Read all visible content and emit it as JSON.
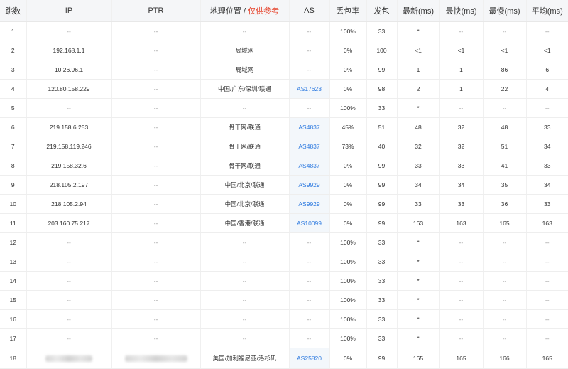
{
  "columns": {
    "hop": "跳数",
    "ip": "IP",
    "ptr": "PTR",
    "geo": "地理位置",
    "geo_sep": "/",
    "geo_note": "仅供参考",
    "as": "AS",
    "loss": "丢包率",
    "sent": "发包",
    "last": "最新(ms)",
    "best": "最快(ms)",
    "worst": "最慢(ms)",
    "avg": "平均(ms)"
  },
  "rows": [
    {
      "hop": "1",
      "ip": "--",
      "ptr": "--",
      "geo": "--",
      "as": "--",
      "loss": "100%",
      "sent": "33",
      "last": "*",
      "best": "--",
      "worst": "--",
      "avg": "--"
    },
    {
      "hop": "2",
      "ip": "192.168.1.1",
      "ptr": "--",
      "geo": "局域网",
      "as": "--",
      "loss": "0%",
      "sent": "100",
      "last": "<1",
      "best": "<1",
      "worst": "<1",
      "avg": "<1"
    },
    {
      "hop": "3",
      "ip": "10.26.96.1",
      "ptr": "--",
      "geo": "局域网",
      "as": "--",
      "loss": "0%",
      "sent": "99",
      "last": "1",
      "best": "1",
      "worst": "86",
      "avg": "6"
    },
    {
      "hop": "4",
      "ip": "120.80.158.229",
      "ptr": "--",
      "geo": "中国/广东/深圳/联通",
      "as": "AS17623",
      "loss": "0%",
      "sent": "98",
      "last": "2",
      "best": "1",
      "worst": "22",
      "avg": "4"
    },
    {
      "hop": "5",
      "ip": "--",
      "ptr": "--",
      "geo": "--",
      "as": "--",
      "loss": "100%",
      "sent": "33",
      "last": "*",
      "best": "--",
      "worst": "--",
      "avg": "--"
    },
    {
      "hop": "6",
      "ip": "219.158.6.253",
      "ptr": "--",
      "geo": "骨干网/联通",
      "as": "AS4837",
      "loss": "45%",
      "sent": "51",
      "last": "48",
      "best": "32",
      "worst": "48",
      "avg": "33"
    },
    {
      "hop": "7",
      "ip": "219.158.119.246",
      "ptr": "--",
      "geo": "骨干网/联通",
      "as": "AS4837",
      "loss": "73%",
      "sent": "40",
      "last": "32",
      "best": "32",
      "worst": "51",
      "avg": "34"
    },
    {
      "hop": "8",
      "ip": "219.158.32.6",
      "ptr": "--",
      "geo": "骨干网/联通",
      "as": "AS4837",
      "loss": "0%",
      "sent": "99",
      "last": "33",
      "best": "33",
      "worst": "41",
      "avg": "33"
    },
    {
      "hop": "9",
      "ip": "218.105.2.197",
      "ptr": "--",
      "geo": "中国/北京/联通",
      "as": "AS9929",
      "loss": "0%",
      "sent": "99",
      "last": "34",
      "best": "34",
      "worst": "35",
      "avg": "34"
    },
    {
      "hop": "10",
      "ip": "218.105.2.94",
      "ptr": "--",
      "geo": "中国/北京/联通",
      "as": "AS9929",
      "loss": "0%",
      "sent": "99",
      "last": "33",
      "best": "33",
      "worst": "36",
      "avg": "33"
    },
    {
      "hop": "11",
      "ip": "203.160.75.217",
      "ptr": "--",
      "geo": "中国/香港/联通",
      "as": "AS10099",
      "loss": "0%",
      "sent": "99",
      "last": "163",
      "best": "163",
      "worst": "165",
      "avg": "163"
    },
    {
      "hop": "12",
      "ip": "--",
      "ptr": "--",
      "geo": "--",
      "as": "--",
      "loss": "100%",
      "sent": "33",
      "last": "*",
      "best": "--",
      "worst": "--",
      "avg": "--"
    },
    {
      "hop": "13",
      "ip": "--",
      "ptr": "--",
      "geo": "--",
      "as": "--",
      "loss": "100%",
      "sent": "33",
      "last": "*",
      "best": "--",
      "worst": "--",
      "avg": "--"
    },
    {
      "hop": "14",
      "ip": "--",
      "ptr": "--",
      "geo": "--",
      "as": "--",
      "loss": "100%",
      "sent": "33",
      "last": "*",
      "best": "--",
      "worst": "--",
      "avg": "--"
    },
    {
      "hop": "15",
      "ip": "--",
      "ptr": "--",
      "geo": "--",
      "as": "--",
      "loss": "100%",
      "sent": "33",
      "last": "*",
      "best": "--",
      "worst": "--",
      "avg": "--"
    },
    {
      "hop": "16",
      "ip": "--",
      "ptr": "--",
      "geo": "--",
      "as": "--",
      "loss": "100%",
      "sent": "33",
      "last": "*",
      "best": "--",
      "worst": "--",
      "avg": "--"
    },
    {
      "hop": "17",
      "ip": "--",
      "ptr": "--",
      "geo": "--",
      "as": "--",
      "loss": "100%",
      "sent": "33",
      "last": "*",
      "best": "--",
      "worst": "--",
      "avg": "--"
    },
    {
      "hop": "18",
      "ip": "",
      "ptr": "",
      "geo": "美国/加利福尼亚/洛杉矶",
      "as": "AS25820",
      "loss": "0%",
      "sent": "99",
      "last": "165",
      "best": "165",
      "worst": "166",
      "avg": "165",
      "ip_redacted": true,
      "ptr_redacted": true
    }
  ]
}
